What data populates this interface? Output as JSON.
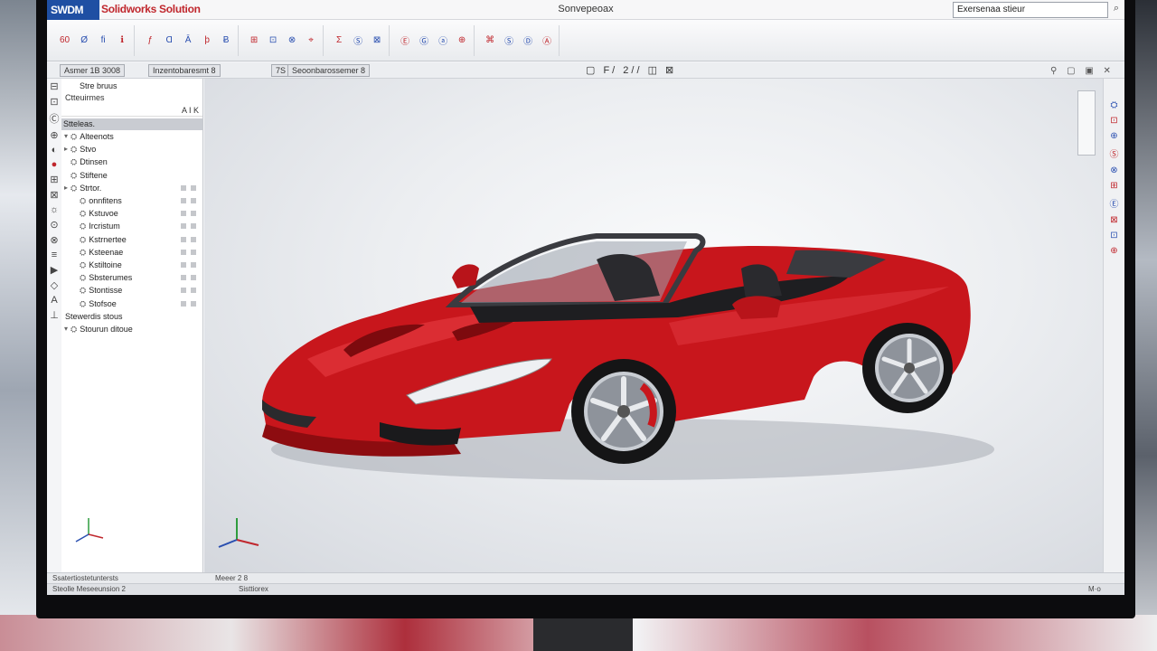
{
  "window": {
    "logo": "SWDM",
    "logo_text": "Solidworks Solution",
    "title": "Sonvepeoax",
    "search_text": "Exersenaa stieur",
    "search_icon": "magnifier-icon"
  },
  "toolbar": {
    "groups": [
      [
        "60",
        "Ø",
        "fi",
        "ℹ"
      ],
      [
        "ƒ",
        "Ɑ",
        "Ā",
        "þ",
        "Ƀ"
      ],
      [
        "⊞",
        "⊡",
        "⊗",
        "⌖"
      ],
      [
        "Ʃ",
        "Ⓢ",
        "⊠"
      ],
      [
        "Ⓔ",
        "Ⓖ",
        "ⓐ",
        "⊕"
      ],
      [
        "⌘",
        "Ⓢ",
        "Ⓓ",
        "Ⓐ"
      ]
    ]
  },
  "tabs": [
    "Asmer 1B 3008",
    "Inzentobaresmt 8",
    "7S",
    "Seoonbarossemer 8"
  ],
  "viewtools": "▢ F/ 2// ◫ ⊠",
  "tree": {
    "header": "Stre bruus",
    "sub": "Ctteuirmes",
    "filter": "A I K",
    "section": "Stteleas.",
    "items": [
      {
        "label": "Alteenots",
        "twisty": "▾",
        "icon": "⛭",
        "status": false
      },
      {
        "label": "Stvo",
        "twisty": "▸",
        "icon": "⛭",
        "status": false
      },
      {
        "label": "Dtinsen",
        "twisty": "",
        "icon": "⛭",
        "status": false
      },
      {
        "label": "Stiftene",
        "twisty": "",
        "icon": "⛭",
        "status": false
      },
      {
        "label": "Strtor.",
        "twisty": "▸",
        "icon": "⛭",
        "status": true
      },
      {
        "label": "onnfitens",
        "twisty": "",
        "icon": "⛭",
        "status": true
      },
      {
        "label": "Kstuvoe",
        "twisty": "",
        "icon": "⛭",
        "status": true
      },
      {
        "label": "Ircristum",
        "twisty": "",
        "icon": "⛭",
        "status": true
      },
      {
        "label": "Kstrnertee",
        "twisty": "",
        "icon": "⛭",
        "status": true
      },
      {
        "label": "Ksteenae",
        "twisty": "",
        "icon": "⛭",
        "status": true
      },
      {
        "label": "Kstiltoine",
        "twisty": "",
        "icon": "⛭",
        "status": true
      },
      {
        "label": "Sbsterumes",
        "twisty": "",
        "icon": "⛭",
        "status": true
      },
      {
        "label": "Stontisse",
        "twisty": "",
        "icon": "⛭",
        "status": true
      },
      {
        "label": "Stofsoe",
        "twisty": "",
        "icon": "⛭",
        "status": true
      }
    ],
    "footer1": "Stewerdis stous",
    "footer2": "Stourun ditoue"
  },
  "right_strip_icons": [
    "⛭",
    "⊡",
    "⊕",
    "Ⓢ",
    "⊗",
    "⊞",
    "Ⓔ",
    "⊠",
    "⊡",
    "⊕"
  ],
  "status": {
    "bar1_left": "Ssatertiostetuntersts",
    "bar1_mid": "Meeer 2 8",
    "bar2_left": "Steolle Meseeunsion 2",
    "bar2_mid": "Sisttiorex",
    "bar2_right": "M·o"
  },
  "colors": {
    "car_body": "#c8161c",
    "logo_bg": "#1f4fa3",
    "accent_red": "#c0272d"
  }
}
